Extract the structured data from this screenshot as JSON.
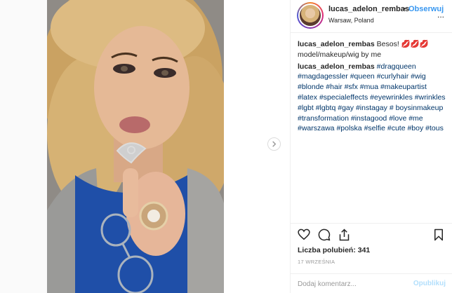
{
  "post": {
    "username": "lucas_adelon_rembas",
    "separator": "•",
    "follow_label": "Obserwuj",
    "location": "Warsaw, Poland",
    "more_label": "..."
  },
  "caption": {
    "author": "lucas_adelon_rembas",
    "text": "Besos! 💋💋💋 model/makeup/wig by me"
  },
  "hashtags_comment": {
    "author": "lucas_adelon_rembas",
    "tags": [
      "#dragqueen",
      "#magdagessler",
      "#queen",
      "#curlyhair",
      "#wig",
      "#blonde",
      "#hair",
      "#sfx",
      "#mua",
      "#makeupartist",
      "#latex",
      "#specialeffects",
      "#eyewrinkles",
      "#wrinkles",
      "#lgbt",
      "#lgbtq",
      "#gay",
      "#instagay",
      "#",
      "boysinmakeup",
      "#transformation",
      "#instagood",
      "#love",
      "#me",
      "#warszawa",
      "#polska",
      "#selfie",
      "#cute",
      "#boy",
      "#tous"
    ]
  },
  "engagement": {
    "likes_label": "Liczba polubień: 341",
    "date": "17 WRZEŚNIA"
  },
  "comment": {
    "placeholder": "Dodaj komentarz...",
    "post_label": "Opublikuj"
  },
  "icons": {
    "like": "heart-icon",
    "comment": "comment-bubble-icon",
    "share": "share-icon",
    "save": "bookmark-icon",
    "next": "chevron-right-icon"
  },
  "colors": {
    "link": "#003569",
    "follow": "#3897f0",
    "muted": "#999999"
  }
}
